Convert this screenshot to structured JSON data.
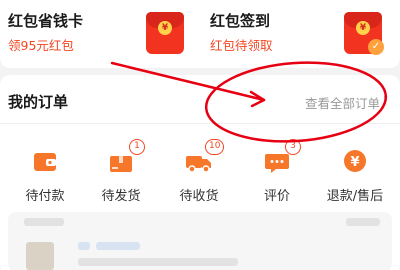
{
  "promo": {
    "left": {
      "title": "红包省钱卡",
      "subtitle": "领95元红包"
    },
    "right": {
      "title": "红包签到",
      "subtitle": "红包待领取"
    },
    "coin_symbol": "¥"
  },
  "orders": {
    "title": "我的订单",
    "view_all": "查看全部订单",
    "chevron": "›",
    "items": [
      {
        "label": "待付款",
        "icon": "wallet-icon",
        "badge": ""
      },
      {
        "label": "待发货",
        "icon": "package-icon",
        "badge": "1"
      },
      {
        "label": "待收货",
        "icon": "truck-icon",
        "badge": "10"
      },
      {
        "label": "评价",
        "icon": "comment-icon",
        "badge": "3"
      },
      {
        "label": "退款/售后",
        "icon": "refund-icon",
        "badge": ""
      }
    ]
  },
  "colors": {
    "accent": "#f24724",
    "icon_orange": "#f7772a",
    "annotation_red": "#e60012"
  }
}
